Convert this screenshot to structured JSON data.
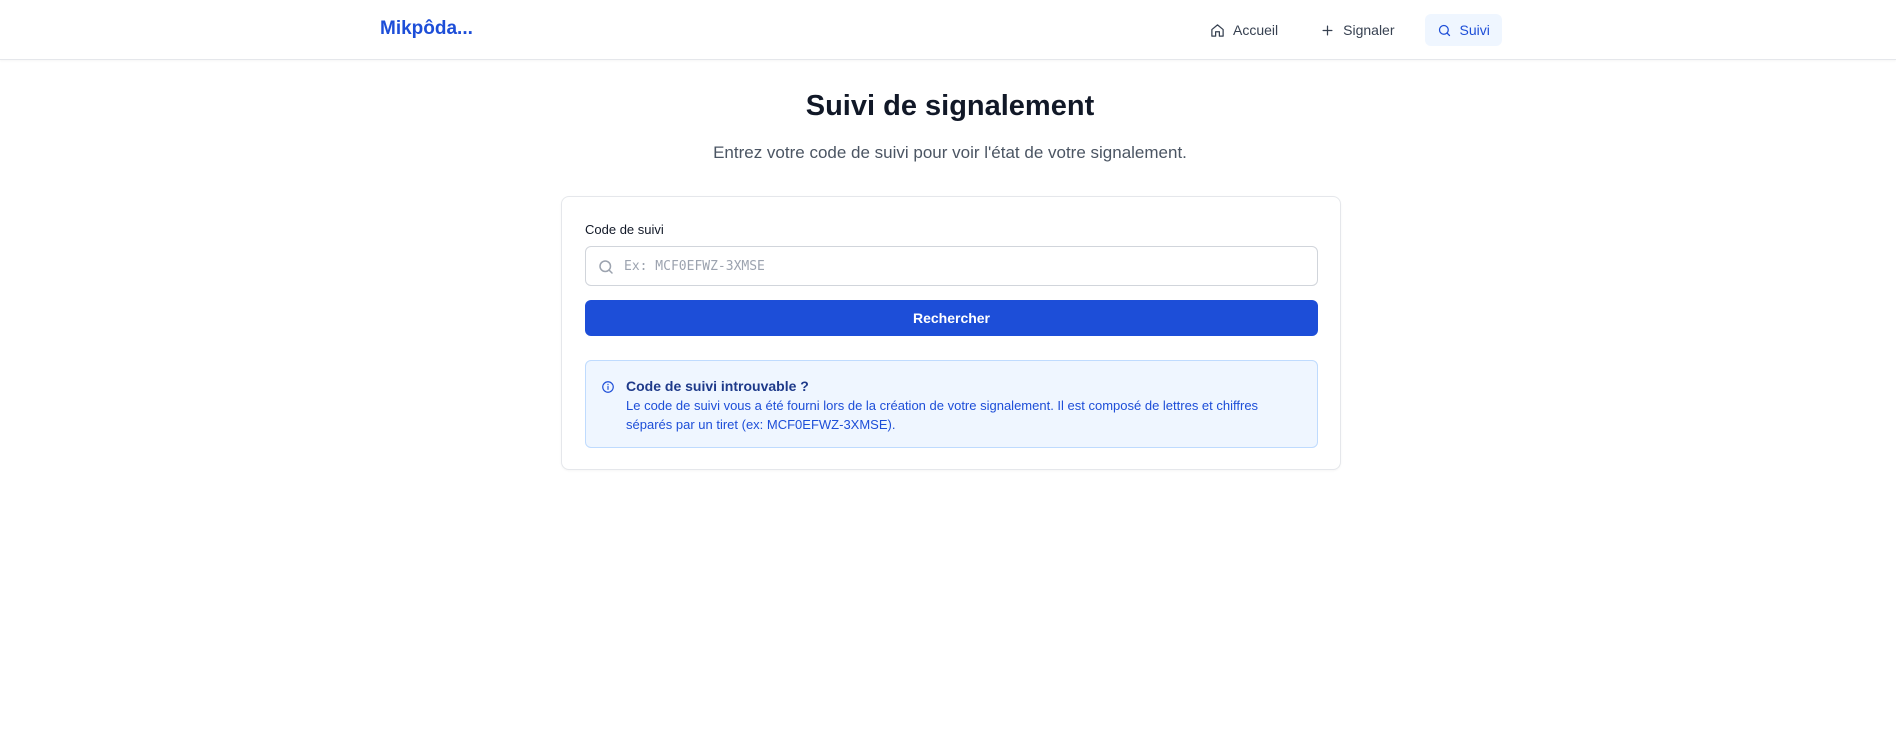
{
  "header": {
    "brand": "Mikpôda...",
    "nav": [
      {
        "label": "Accueil",
        "icon": "home-icon",
        "active": false
      },
      {
        "label": "Signaler",
        "icon": "plus-icon",
        "active": false
      },
      {
        "label": "Suivi",
        "icon": "search-icon",
        "active": true
      }
    ]
  },
  "main": {
    "title": "Suivi de signalement",
    "subtitle": "Entrez votre code de suivi pour voir l'état de votre signalement.",
    "form": {
      "label": "Code de suivi",
      "value": "",
      "placeholder": "Ex: MCF0EFWZ-3XMSE",
      "button_label": "Rechercher"
    },
    "info": {
      "icon": "info-icon",
      "title": "Code de suivi introuvable ?",
      "text": "Le code de suivi vous a été fourni lors de la création de votre signalement. Il est composé de lettres et chiffres séparés par un tiret (ex: MCF0EFWZ-3XMSE)."
    }
  },
  "colors": {
    "primary": "#1d4ed8",
    "info_background": "#eff6ff",
    "info_border": "#bfdbfe",
    "nav_active_background": "#eff6ff"
  }
}
